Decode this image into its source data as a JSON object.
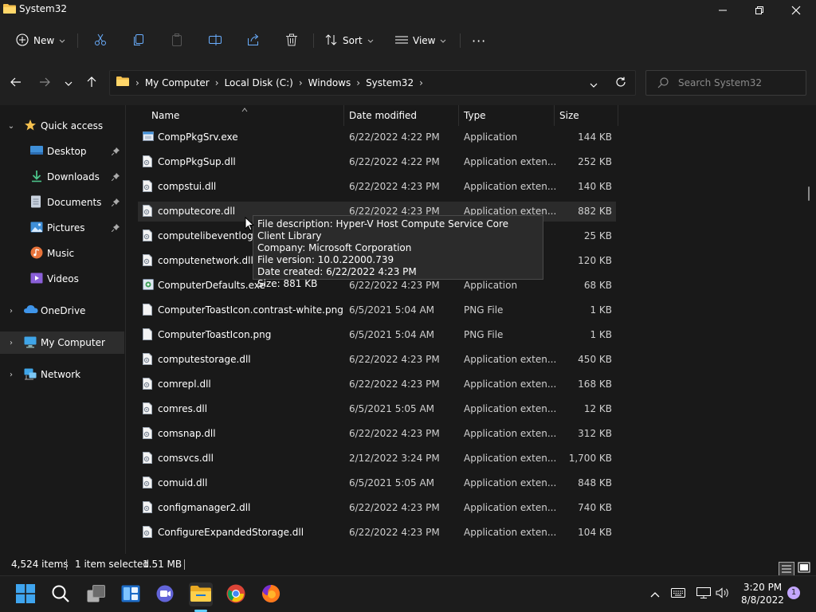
{
  "window": {
    "title": "System32"
  },
  "toolbar": {
    "new_label": "New",
    "sort_label": "Sort",
    "view_label": "View",
    "more_label": "···"
  },
  "address": {
    "crumbs": [
      "My Computer",
      "Local Disk (C:)",
      "Windows",
      "System32"
    ]
  },
  "search": {
    "placeholder": "Search System32"
  },
  "nav": {
    "items": [
      {
        "label": "Quick access"
      },
      {
        "label": "Desktop"
      },
      {
        "label": "Downloads"
      },
      {
        "label": "Documents"
      },
      {
        "label": "Pictures"
      },
      {
        "label": "Music"
      },
      {
        "label": "Videos"
      },
      {
        "label": "OneDrive"
      },
      {
        "label": "My Computer"
      },
      {
        "label": "Network"
      }
    ]
  },
  "columns": {
    "name": "Name",
    "date": "Date modified",
    "type": "Type",
    "size": "Size"
  },
  "files": [
    {
      "name": "CompPkgSrv.exe",
      "date": "6/22/2022 4:22 PM",
      "type": "Application",
      "size": "144 KB"
    },
    {
      "name": "CompPkgSup.dll",
      "date": "6/22/2022 4:22 PM",
      "type": "Application exten...",
      "size": "252 KB"
    },
    {
      "name": "compstui.dll",
      "date": "6/22/2022 4:23 PM",
      "type": "Application exten...",
      "size": "140 KB"
    },
    {
      "name": "computecore.dll",
      "date": "6/22/2022 4:23 PM",
      "type": "Application exten...",
      "size": "882 KB"
    },
    {
      "name": "computelibeventlog.dll",
      "date": "",
      "type": "",
      "size": "25 KB"
    },
    {
      "name": "computenetwork.dll",
      "date": "",
      "type": "",
      "size": "120 KB"
    },
    {
      "name": "ComputerDefaults.exe",
      "date": "6/22/2022 4:23 PM",
      "type": "Application",
      "size": "68 KB"
    },
    {
      "name": "ComputerToastIcon.contrast-white.png",
      "date": "6/5/2021 5:04 AM",
      "type": "PNG File",
      "size": "1 KB"
    },
    {
      "name": "ComputerToastIcon.png",
      "date": "6/5/2021 5:04 AM",
      "type": "PNG File",
      "size": "1 KB"
    },
    {
      "name": "computestorage.dll",
      "date": "6/22/2022 4:23 PM",
      "type": "Application exten...",
      "size": "450 KB"
    },
    {
      "name": "comrepl.dll",
      "date": "6/22/2022 4:23 PM",
      "type": "Application exten...",
      "size": "168 KB"
    },
    {
      "name": "comres.dll",
      "date": "6/5/2021 5:05 AM",
      "type": "Application exten...",
      "size": "12 KB"
    },
    {
      "name": "comsnap.dll",
      "date": "6/22/2022 4:23 PM",
      "type": "Application exten...",
      "size": "312 KB"
    },
    {
      "name": "comsvcs.dll",
      "date": "2/12/2022 3:24 PM",
      "type": "Application exten...",
      "size": "1,700 KB"
    },
    {
      "name": "comuid.dll",
      "date": "6/5/2021 5:05 AM",
      "type": "Application exten...",
      "size": "848 KB"
    },
    {
      "name": "configmanager2.dll",
      "date": "6/22/2022 4:23 PM",
      "type": "Application exten...",
      "size": "740 KB"
    },
    {
      "name": "ConfigureExpandedStorage.dll",
      "date": "6/22/2022 4:23 PM",
      "type": "Application exten...",
      "size": "104 KB"
    }
  ],
  "tooltip": {
    "line1": "File description: Hyper-V Host Compute Service Core Client Library",
    "line2": "Company: Microsoft Corporation",
    "line3": "File version: 10.0.22000.739",
    "line4": "Date created: 6/22/2022 4:23 PM",
    "line5": "Size: 881 KB"
  },
  "status": {
    "items_count": "4,524 items",
    "selected": "1 item selected",
    "selected_size": "1.51 MB"
  },
  "taskbar": {
    "time": "3:20 PM",
    "date": "8/8/2022",
    "notification_count": "1"
  },
  "colors": {
    "accent": "#60cdff",
    "folder": "#f4c04e",
    "background": "#191919"
  }
}
